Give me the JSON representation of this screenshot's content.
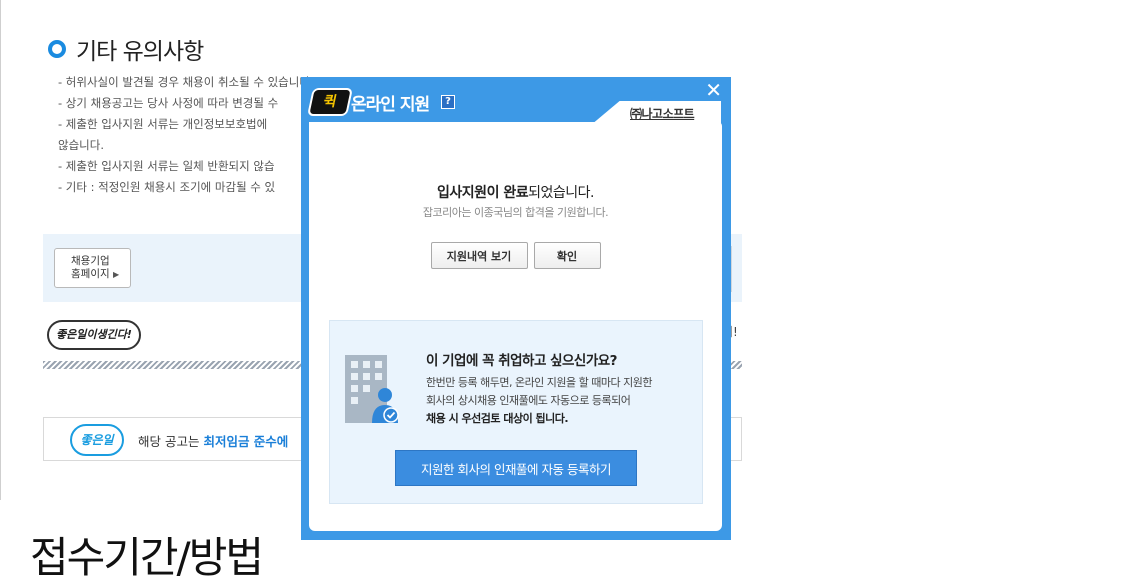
{
  "section": {
    "title": "기타 유의사항",
    "notes": [
      "- 허위사실이 발견될 경우 채용이 취소될 수 있습니다.",
      "- 상기 채용공고는 당사 사정에 따라 변경될 수",
      "- 제출한 입사지원 서류는 개인정보보호법에",
      "않습니다.",
      "- 제출한 입사지원 서류는 일체 반환되지 않습",
      "- 기타 : 적정인원 채용시 조기에 마감될 수 있"
    ]
  },
  "company_home_button": {
    "line1": "채용기업",
    "line2": "홈페이지",
    "arrow": "▶"
  },
  "good_job_badge": "좋은일이생긴다!",
  "right_cut_text": "서!",
  "wage": {
    "logo": "좋은일",
    "prefix": "해당 공고는 ",
    "highlight": "최저임금 준수에"
  },
  "bottom_title": "접수기간/방법",
  "popup": {
    "logo": "퀵",
    "title": "온라인 지원",
    "help": "?",
    "close": "✕",
    "company": "㈜나고소프트",
    "done_bold": "입사지원이 완료",
    "done_rest": "되었습니다.",
    "wish": "잡코리아는 이종국님의 합격을 기원합니다.",
    "view_button": "지원내역 보기",
    "ok_button": "확인",
    "promo_title": "이 기업에 꼭 취업하고 싶으신가요?",
    "promo_line1": "한번만 등록 해두면, 온라인 지원을 할 때마다 지원한",
    "promo_line2": "회사의 상시채용 인재풀에도 자동으로 등록되어",
    "promo_line3": "채용 시 우선검토 대상이 됩니다.",
    "register_button": "지원한 회사의 인재풀에 자동 등록하기"
  },
  "colors": {
    "accent_blue": "#3d99e6",
    "button_blue": "#3b8de0",
    "promo_bg": "#eaf4fd",
    "highlight_text": "#1a7fd8"
  },
  "icons": [
    "circle-ring-icon",
    "close-icon",
    "help-icon",
    "building-user-icon",
    "check-badge-icon",
    "arrow-right-icon"
  ]
}
